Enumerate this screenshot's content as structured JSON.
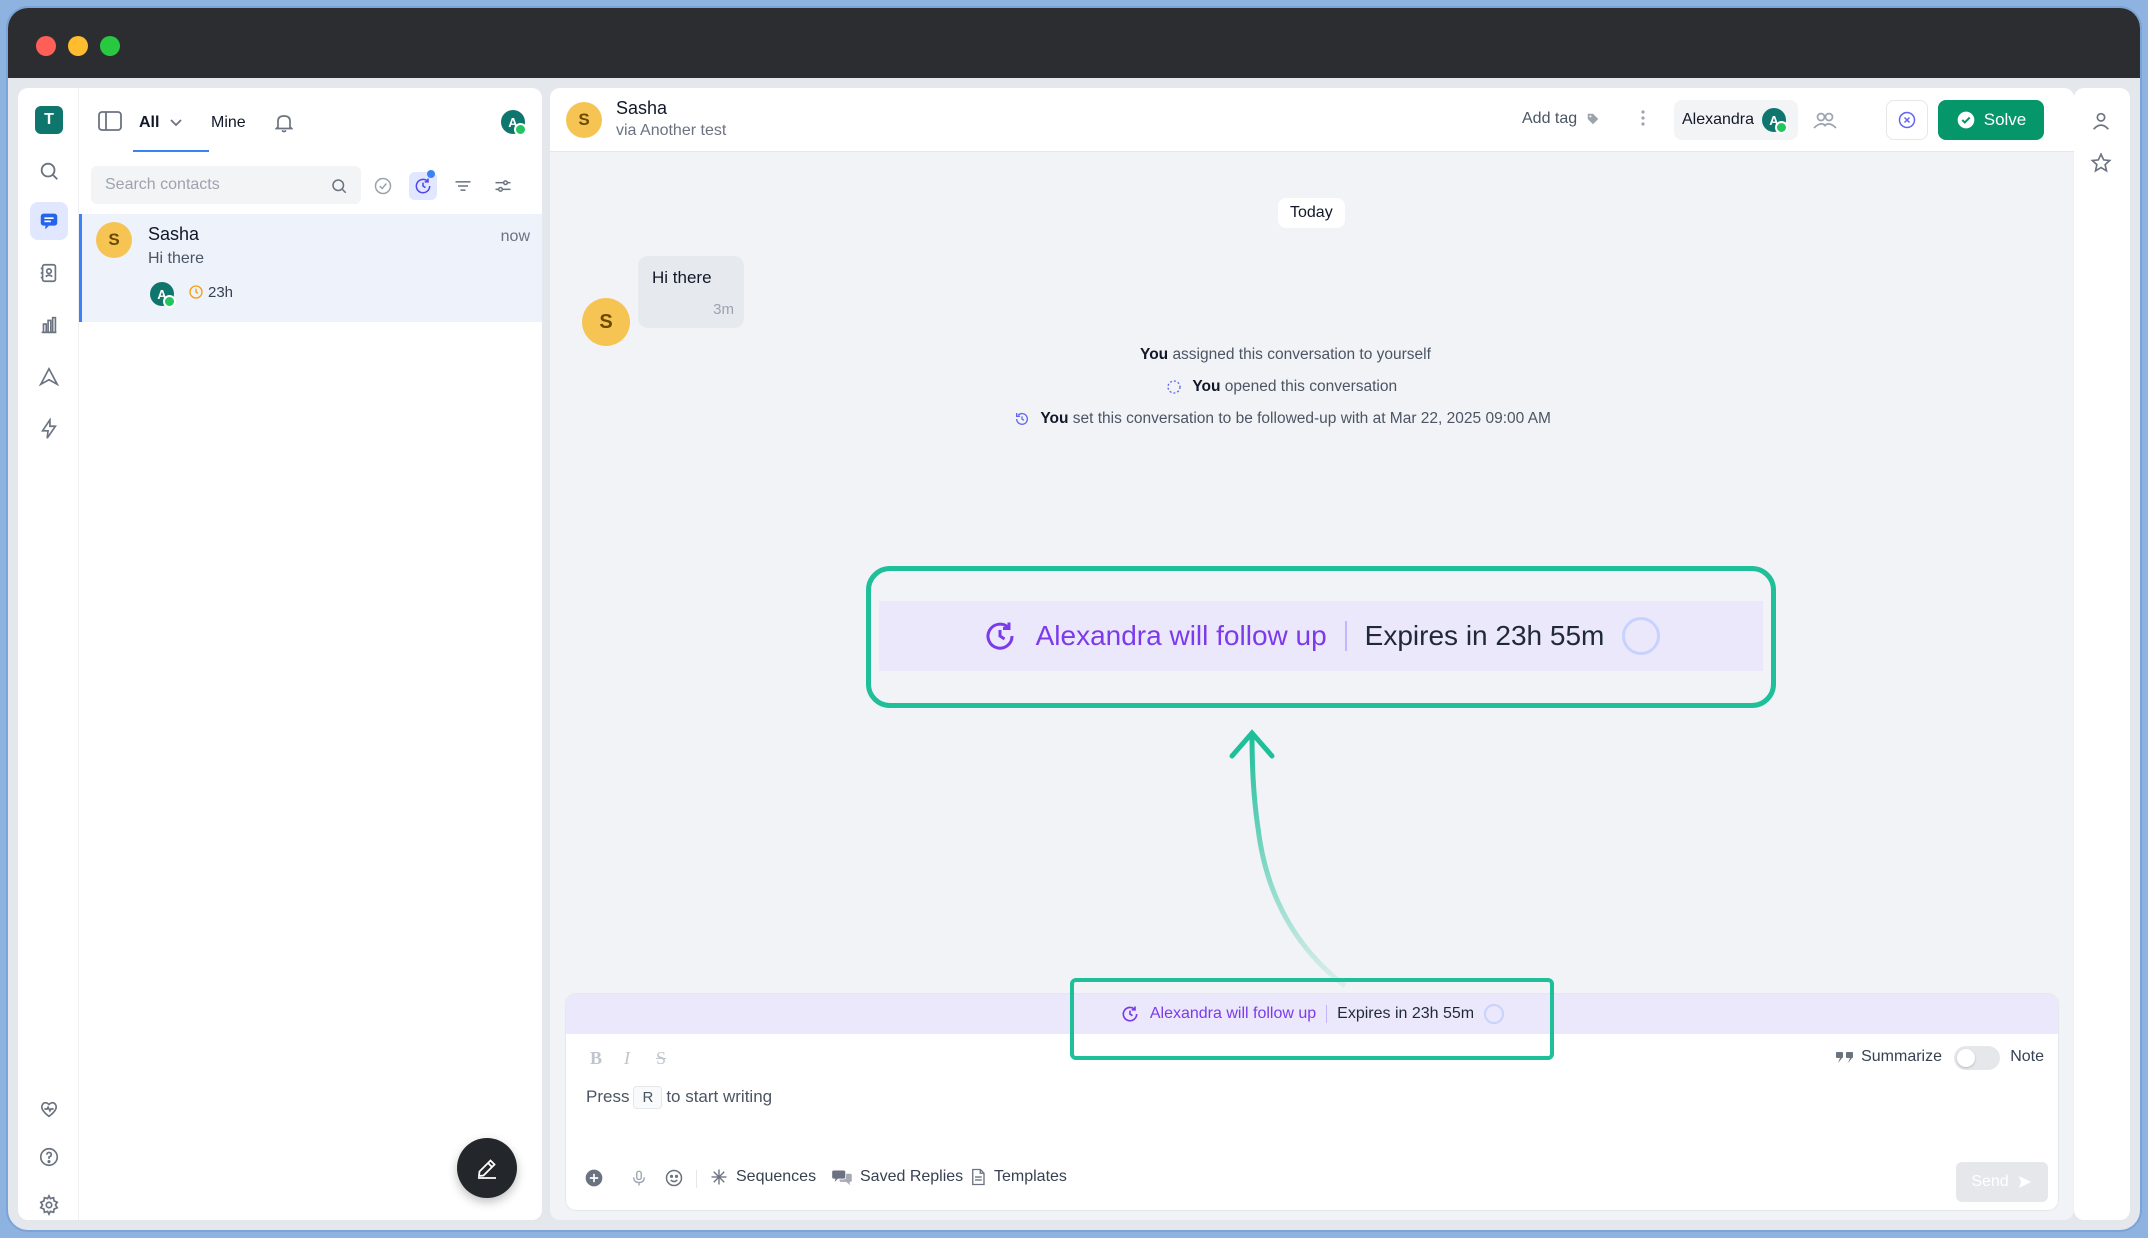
{
  "app": {
    "logo_letter": "T"
  },
  "list": {
    "tab_all": "All",
    "tab_mine": "Mine",
    "search_placeholder": "Search contacts",
    "conversations": [
      {
        "avatar": "S",
        "name": "Sasha",
        "preview": "Hi there",
        "time": "now",
        "assignee_avatar": "A",
        "timer": "23h"
      }
    ]
  },
  "header": {
    "contact_avatar": "S",
    "contact_name": "Sasha",
    "channel": "via Another test",
    "add_tag": "Add tag",
    "assignee": "Alexandra",
    "assignee_avatar": "A",
    "solve": "Solve",
    "user_avatar": "A"
  },
  "timeline": {
    "date_pill": "Today",
    "message": {
      "avatar": "S",
      "text": "Hi there",
      "time": "3m"
    },
    "events": [
      {
        "actor": "You",
        "text": "assigned this conversation to yourself"
      },
      {
        "actor": "You",
        "text": "opened this conversation"
      },
      {
        "actor": "You",
        "text": "set this conversation to be followed-up with at Mar 22, 2025 09:00 AM"
      }
    ]
  },
  "followup": {
    "label": "Alexandra will follow up",
    "expires": "Expires in 23h 55m"
  },
  "composer": {
    "summarize": "Summarize",
    "note": "Note",
    "press": "Press",
    "key": "R",
    "to_start": "to start writing",
    "sequences": "Sequences",
    "saved_replies": "Saved Replies",
    "templates": "Templates",
    "send": "Send"
  },
  "colors": {
    "accent": "#1fbf9a",
    "primary": "#059669",
    "followup_text": "#7c3aed",
    "followup_bg": "#ece8fb",
    "avatar_yellow": "#f6c453",
    "avatar_teal": "#0f766e"
  }
}
